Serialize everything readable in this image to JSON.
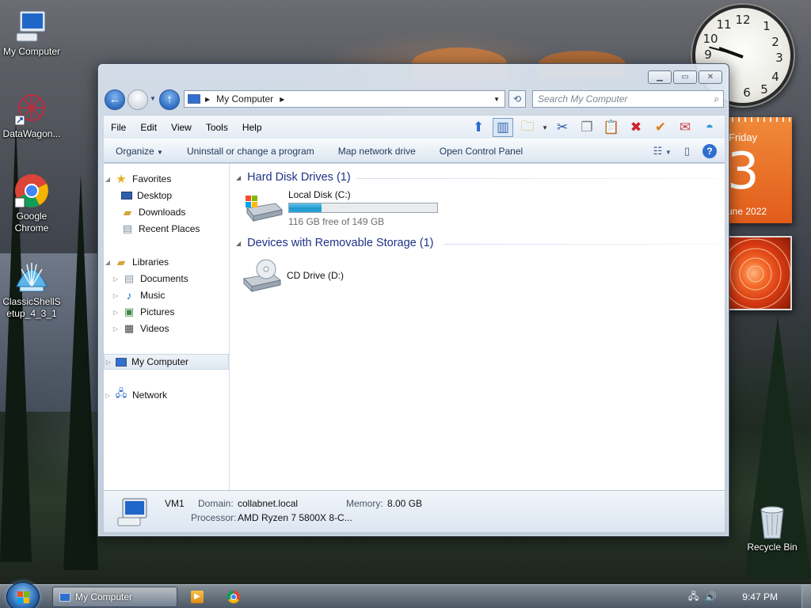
{
  "desktop": {
    "icons": [
      {
        "label": "My Computer",
        "icon": "computer-icon"
      },
      {
        "label": "DataWagon...",
        "icon": "datawagon-icon"
      },
      {
        "label": "Google Chrome",
        "icon": "chrome-icon"
      },
      {
        "label": "ClassicShellSetup_4_3_1",
        "icon": "classicshell-icon"
      },
      {
        "label": "Recycle Bin",
        "icon": "recycle-bin-icon"
      }
    ]
  },
  "gadgets": {
    "calendar": {
      "day_name": "Friday",
      "day_number": "3",
      "month_year": "une 2022"
    }
  },
  "window": {
    "address": {
      "location": "My Computer",
      "search_placeholder": "Search My Computer"
    },
    "menu": [
      "File",
      "Edit",
      "View",
      "Tools",
      "Help"
    ],
    "commands": [
      "Organize",
      "Uninstall or change a program",
      "Map network drive",
      "Open Control Panel"
    ],
    "nav": {
      "favorites": "Favorites",
      "desktop": "Desktop",
      "downloads": "Downloads",
      "recent": "Recent Places",
      "libraries": "Libraries",
      "documents": "Documents",
      "music": "Music",
      "pictures": "Pictures",
      "videos": "Videos",
      "my_computer": "My Computer",
      "network": "Network"
    },
    "groups": {
      "hard_disks": "Hard Disk Drives (1)",
      "removable": "Devices with Removable Storage (1)"
    },
    "drives": {
      "local": {
        "name": "Local Disk (C:)",
        "free": "116 GB free of 149 GB",
        "used_fraction": 0.22
      },
      "cd": {
        "name": "CD Drive (D:)"
      }
    },
    "details": {
      "name": "VM1",
      "domain_label": "Domain:",
      "domain_value": "collabnet.local",
      "memory_label": "Memory:",
      "memory_value": "8.00 GB",
      "processor_label": "Processor:",
      "processor_value": "AMD Ryzen 7 5800X 8-C..."
    }
  },
  "taskbar": {
    "active_window": "My Computer",
    "time": "9:47 PM"
  }
}
